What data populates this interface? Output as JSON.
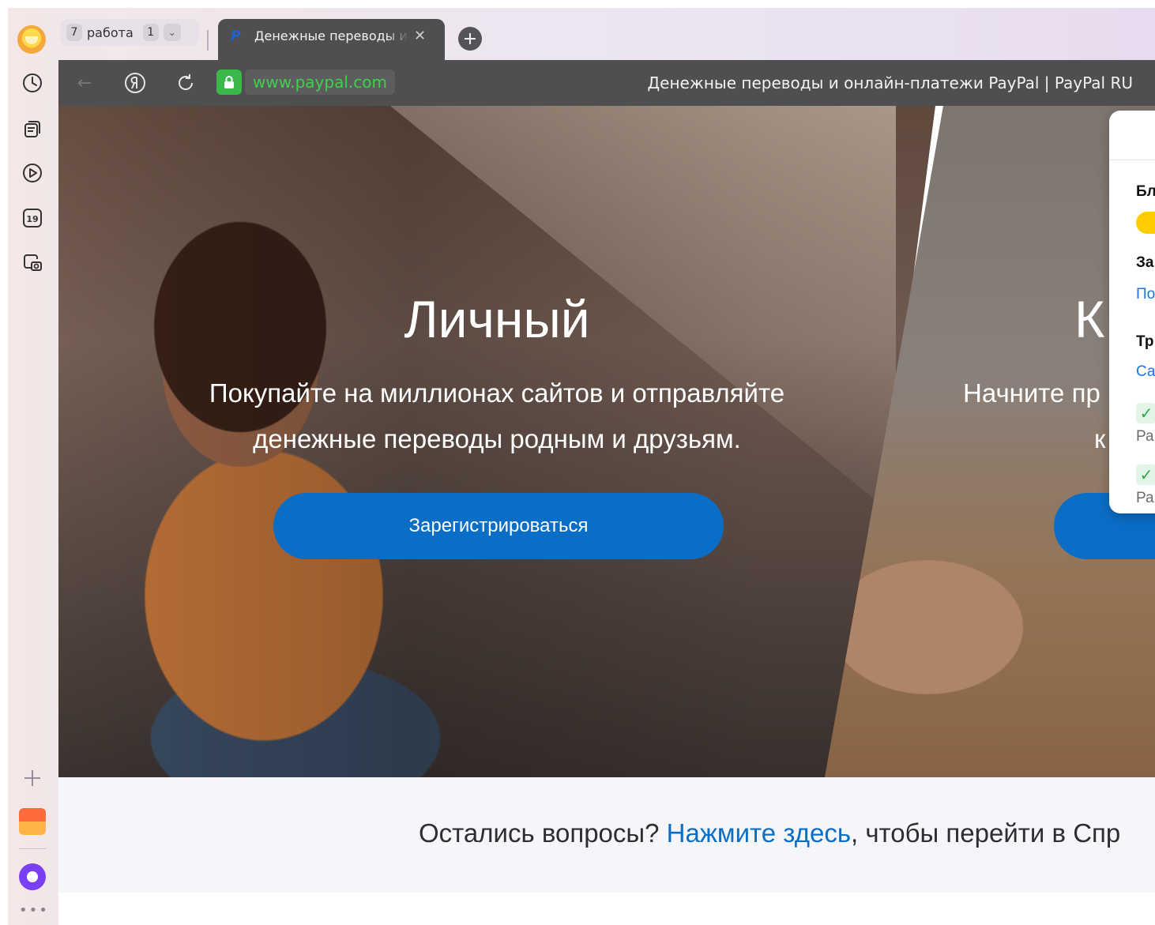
{
  "browser": {
    "tab_group": {
      "count": "7",
      "label": "работа",
      "extra_count": "1"
    },
    "active_tab": {
      "title": "Денежные переводы и онлайн-платежи PayPal | PayPal RU",
      "short_title": "Денежные переводы и"
    },
    "address": {
      "url": "www.paypal.com",
      "page_title": "Денежные переводы и онлайн-платежи PayPal | PayPal RU"
    },
    "sidebar": {
      "calendar_day": "19"
    }
  },
  "hero": {
    "personal": {
      "title": "Личный",
      "text_line1": "Покупайте на миллионах сайтов и отправляйте",
      "text_line2": "денежные переводы родным и друзьям.",
      "button": "Зарегистрироваться"
    },
    "business": {
      "title_fragment": "К",
      "text_fragment": "Начните пр",
      "text_fragment2": "к"
    }
  },
  "popup": {
    "line1": "Бл",
    "line2": "За",
    "line3": "По",
    "line4": "Тр",
    "line5": "Са",
    "line6": "Ра",
    "line7": "Ра"
  },
  "help": {
    "before": "Остались вопросы? ",
    "link": "Нажмите здесь",
    "after": ", чтобы перейти в Спр"
  },
  "colors": {
    "accent": "#0a6ec7",
    "url_green": "#3fd14c",
    "toggle": "#ffcc00"
  }
}
